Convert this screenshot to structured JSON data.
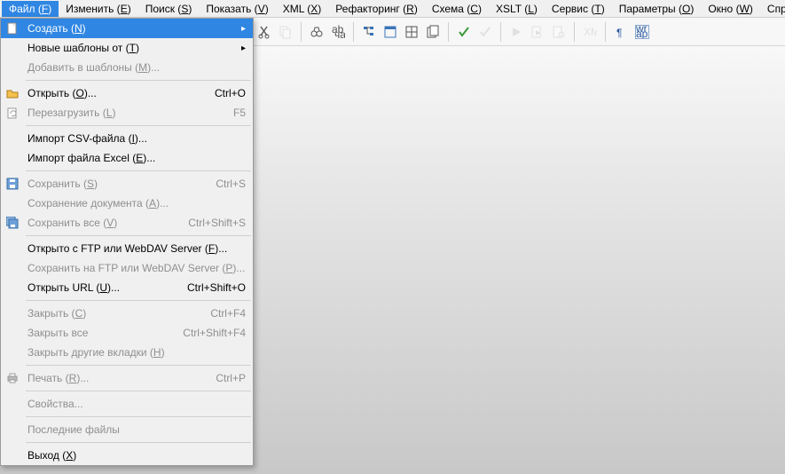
{
  "menubar": [
    {
      "label": "Файл",
      "accel": "F",
      "active": true
    },
    {
      "label": "Изменить",
      "accel": "E"
    },
    {
      "label": "Поиск",
      "accel": "S"
    },
    {
      "label": "Показать",
      "accel": "V"
    },
    {
      "label": "XML",
      "accel": "X"
    },
    {
      "label": "Рефакторинг",
      "accel": "R"
    },
    {
      "label": "Схема",
      "accel": "C"
    },
    {
      "label": "XSLT",
      "accel": "L"
    },
    {
      "label": "Сервис",
      "accel": "T"
    },
    {
      "label": "Параметры",
      "accel": "O"
    },
    {
      "label": "Окно",
      "accel": "W"
    },
    {
      "label": "Справка",
      "accel": "H"
    }
  ],
  "dropdown": [
    {
      "type": "item",
      "label": "Создать",
      "accel": "N",
      "shortcut": "",
      "submenu": true,
      "highlight": true,
      "icon": "new"
    },
    {
      "type": "item",
      "label": "Новые шаблоны от",
      "accel": "T",
      "shortcut": "",
      "submenu": true
    },
    {
      "type": "item",
      "label": "Добавить в шаблоны",
      "accel": "M",
      "suffix": "...",
      "disabled": true
    },
    {
      "type": "sep"
    },
    {
      "type": "item",
      "label": "Открыть",
      "accel": "O",
      "suffix": "...",
      "shortcut": "Ctrl+O",
      "icon": "open"
    },
    {
      "type": "item",
      "label": "Перезагрузить",
      "accel": "L",
      "shortcut": "F5",
      "disabled": true,
      "icon": "reload"
    },
    {
      "type": "sep"
    },
    {
      "type": "item",
      "label": "Импорт CSV-файла",
      "accel": "I",
      "suffix": "..."
    },
    {
      "type": "item",
      "label": "Импорт файла Excel",
      "accel": "E",
      "suffix": "..."
    },
    {
      "type": "sep"
    },
    {
      "type": "item",
      "label": "Сохранить",
      "accel": "S",
      "shortcut": "Ctrl+S",
      "disabled": true,
      "icon": "save"
    },
    {
      "type": "item",
      "label": "Сохранение документа",
      "accel": "A",
      "suffix": "...",
      "disabled": true
    },
    {
      "type": "item",
      "label": "Сохранить все",
      "accel": "V",
      "shortcut": "Ctrl+Shift+S",
      "disabled": true,
      "icon": "saveall"
    },
    {
      "type": "sep"
    },
    {
      "type": "item",
      "label": "Открыто с FTP или WebDAV Server",
      "accel": "F",
      "suffix": "..."
    },
    {
      "type": "item",
      "label": "Сохранить на FTP или WebDAV Server",
      "accel": "P",
      "suffix": "...",
      "disabled": true
    },
    {
      "type": "item",
      "label": "Открыть URL",
      "accel": "U",
      "suffix": "...",
      "shortcut": "Ctrl+Shift+O"
    },
    {
      "type": "sep"
    },
    {
      "type": "item",
      "label": "Закрыть",
      "accel": "C",
      "shortcut": "Ctrl+F4",
      "disabled": true
    },
    {
      "type": "item",
      "label": "Закрыть все",
      "shortcut": "Ctrl+Shift+F4",
      "disabled": true
    },
    {
      "type": "item",
      "label": "Закрыть другие вкладки",
      "accel": "H",
      "disabled": true
    },
    {
      "type": "sep"
    },
    {
      "type": "item",
      "label": "Печать",
      "accel": "R",
      "suffix": "...",
      "shortcut": "Ctrl+P",
      "disabled": true,
      "icon": "print"
    },
    {
      "type": "sep"
    },
    {
      "type": "item",
      "label": "Свойства...",
      "disabled": true
    },
    {
      "type": "sep"
    },
    {
      "type": "item",
      "label": "Последние файлы",
      "disabled": true
    },
    {
      "type": "sep"
    },
    {
      "type": "item",
      "label": "Выход",
      "accel": "X"
    }
  ],
  "toolbar_icons": [
    {
      "name": "cut-icon",
      "kind": "cut"
    },
    {
      "name": "copy-icon",
      "kind": "copy",
      "disabled": true
    },
    {
      "sep": true
    },
    {
      "name": "find-icon",
      "kind": "binoculars"
    },
    {
      "name": "replace-icon",
      "kind": "replace"
    },
    {
      "sep": true
    },
    {
      "name": "tree-icon",
      "kind": "tree"
    },
    {
      "name": "outline-icon",
      "kind": "outline"
    },
    {
      "name": "grid-icon",
      "kind": "grid"
    },
    {
      "name": "sheets-icon",
      "kind": "sheets"
    },
    {
      "sep": true
    },
    {
      "name": "check-icon",
      "kind": "check"
    },
    {
      "name": "validate-icon",
      "kind": "check2",
      "disabled": true
    },
    {
      "sep": true
    },
    {
      "name": "run-icon",
      "kind": "play",
      "disabled": true
    },
    {
      "name": "transform-icon",
      "kind": "doc-play",
      "disabled": true
    },
    {
      "name": "debug-icon",
      "kind": "doc-gear",
      "disabled": true
    },
    {
      "sep": true
    },
    {
      "name": "xml-icon",
      "kind": "xml",
      "disabled": true
    },
    {
      "sep": true
    },
    {
      "name": "pilcrow-icon",
      "kind": "pilcrow"
    },
    {
      "name": "wrap-icon",
      "kind": "wrap"
    }
  ]
}
